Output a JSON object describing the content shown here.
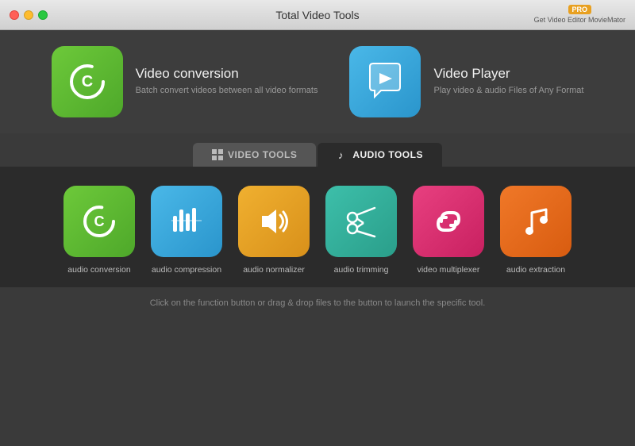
{
  "titleBar": {
    "title": "Total Video Tools",
    "proBadge": "PRO",
    "proLabel": "Get Video Editor MovieMator"
  },
  "cards": [
    {
      "id": "video-conversion",
      "title": "Video conversion",
      "description": "Batch convert videos between all video formats",
      "iconColor": "green"
    },
    {
      "id": "video-player",
      "title": "Video Player",
      "description": "Play video & audio Files of Any Format",
      "iconColor": "blue"
    }
  ],
  "tabs": [
    {
      "id": "video-tools",
      "label": "VIDEO TOOLS",
      "active": false
    },
    {
      "id": "audio-tools",
      "label": "AUDIO TOOLS",
      "active": true
    }
  ],
  "tools": [
    {
      "id": "audio-conversion",
      "label": "audio conversion",
      "colorClass": "tool-green"
    },
    {
      "id": "audio-compression",
      "label": "audio compression",
      "colorClass": "tool-blue"
    },
    {
      "id": "audio-normalizer",
      "label": "audio normalizer",
      "colorClass": "tool-yellow"
    },
    {
      "id": "audio-trimming",
      "label": "audio trimming",
      "colorClass": "tool-teal"
    },
    {
      "id": "video-multiplexer",
      "label": "video multiplexer",
      "colorClass": "tool-pink"
    },
    {
      "id": "audio-extraction",
      "label": "audio extraction",
      "colorClass": "tool-orange"
    }
  ],
  "bottomHint": "Click on the function button or drag & drop files to the button to launch the specific tool."
}
